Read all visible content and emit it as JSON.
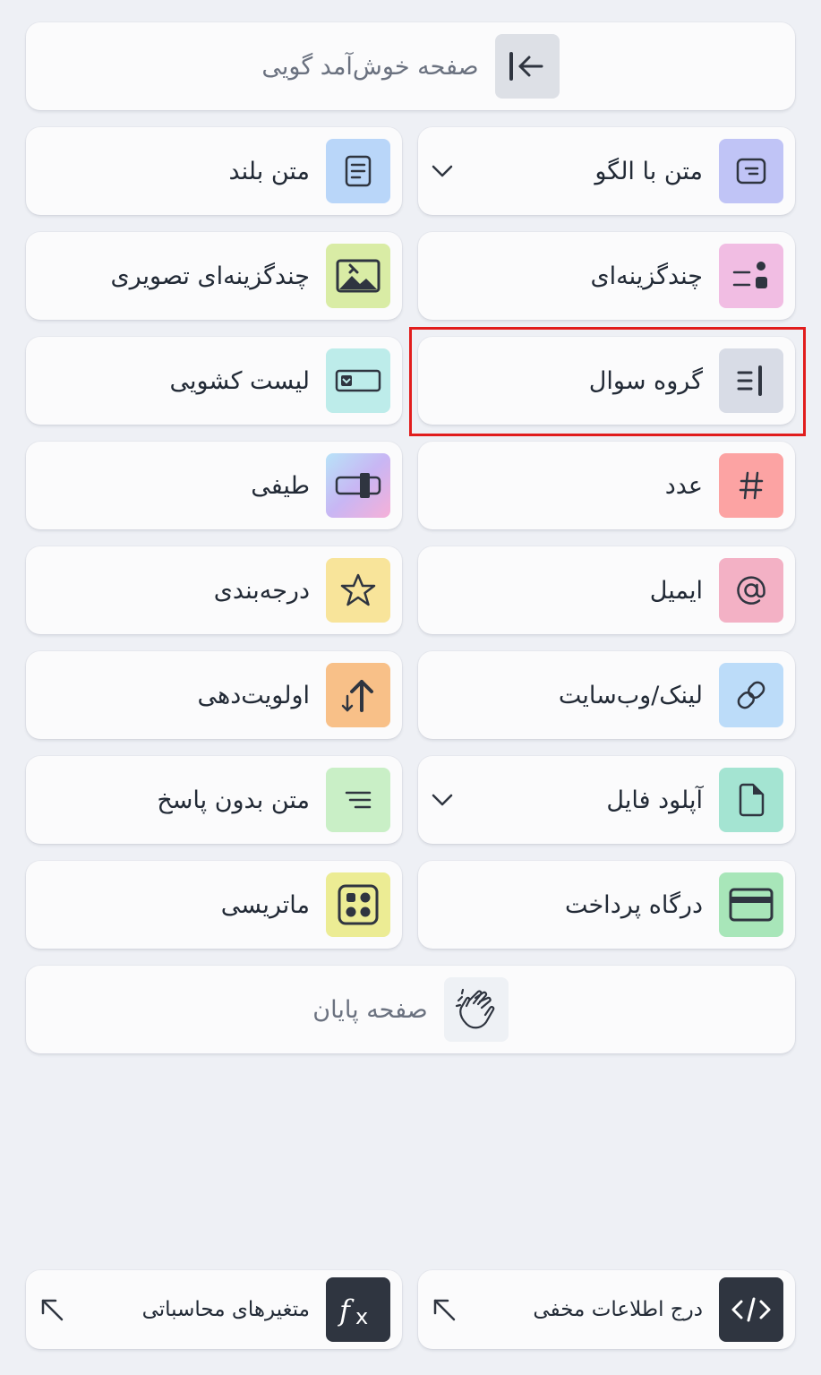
{
  "welcome": {
    "label": "صفحه خوش‌آمد گویی",
    "icon": "arrow-to-left-bar-icon"
  },
  "right_column": [
    {
      "label": "متن با الگو",
      "icon": "pattern-text-icon",
      "color": "#c0c4f6",
      "has_dropdown": true
    },
    {
      "label": "چندگزینه‌ای",
      "icon": "multiple-choice-icon",
      "color": "#f1bde3"
    },
    {
      "label": "گروه سوال",
      "icon": "question-group-icon",
      "color": "#d8dce6",
      "highlighted": true
    },
    {
      "label": "عدد",
      "icon": "hash-icon",
      "color": "#fca3a3"
    },
    {
      "label": "ایمیل",
      "icon": "at-sign-icon",
      "color": "#f3b1c5"
    },
    {
      "label": "لینک/وب‌سایت",
      "icon": "link-icon",
      "color": "#bcdcf9"
    },
    {
      "label": "آپلود فایل",
      "icon": "file-icon",
      "color": "#a4e4d2",
      "has_dropdown": true
    },
    {
      "label": "درگاه پرداخت",
      "icon": "credit-card-icon",
      "color": "#a8e6b9"
    }
  ],
  "left_column": [
    {
      "label": "متن بلند",
      "icon": "long-text-icon",
      "color": "#b9d6f9"
    },
    {
      "label": "چندگزینه‌ای تصویری",
      "icon": "image-icon",
      "color": "#d9eca5"
    },
    {
      "label": "لیست کشویی",
      "icon": "dropdown-list-icon",
      "color": "#bdecea"
    },
    {
      "label": "طیفی",
      "icon": "slider-icon",
      "color": "#c8b6f4"
    },
    {
      "label": "درجه‌بندی",
      "icon": "star-icon",
      "color": "#f8e49a"
    },
    {
      "label": "اولویت‌دهی",
      "icon": "sort-arrows-icon",
      "color": "#f8c088"
    },
    {
      "label": "متن بدون پاسخ",
      "icon": "text-lines-icon",
      "color": "#c9efc6"
    },
    {
      "label": "ماتریسی",
      "icon": "matrix-icon",
      "color": "#ecec94"
    }
  ],
  "end_page": {
    "label": "صفحه پایان",
    "icon": "clapping-hands-icon"
  },
  "bottom": {
    "hidden_data": {
      "label": "درج اطلاعات مخفی",
      "icon": "code-icon"
    },
    "calc_vars": {
      "label": "متغیرهای محاسباتی",
      "icon": "function-icon"
    }
  }
}
